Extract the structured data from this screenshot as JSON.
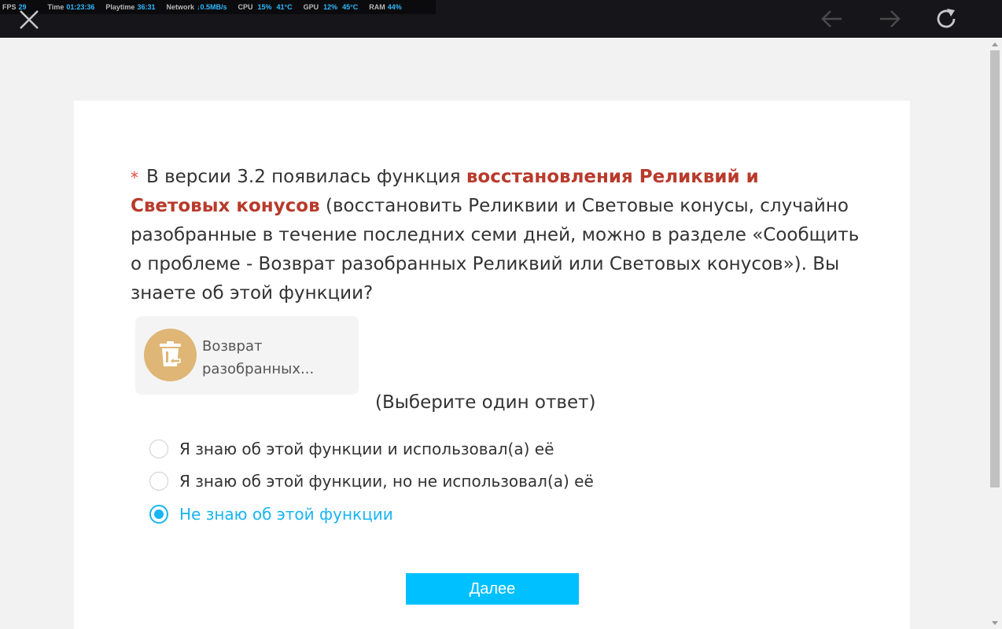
{
  "perf_overlay": {
    "fps_label": "FPS",
    "fps_value": "29",
    "time_label": "Time",
    "time_value": "01:23:36",
    "playtime_label": "Playtime",
    "playtime_value": "36:31",
    "network_label": "Network",
    "network_value": "↓0.5MB/s",
    "cpu_label": "CPU",
    "cpu_load": "15%",
    "cpu_temp": "41°C",
    "gpu_label": "GPU",
    "gpu_load": "12%",
    "gpu_temp": "45°C",
    "ram_label": "RAM",
    "ram_value": "44%"
  },
  "toolbar": {
    "icons": [
      "close-icon",
      "arrow-left-icon",
      "arrow-right-icon",
      "reload-icon"
    ],
    "icon_color_active": "#c8c8c8",
    "icon_color_disabled": "#4a4a4a"
  },
  "question": {
    "required_mark": "*",
    "text_before": "В версии 3.2 появилась функция ",
    "highlight": "восстановления Реликвий и Световых конусов",
    "text_after": " (восстановить Реликвии и Световые конусы, случайно разобранные в течение последних семи дней, можно в разделе «Сообщить о проблеме - Возврат разобранных Реликвий или Световых конусов»). Вы знаете об этой функции?",
    "highlight_color": "#b83a2c"
  },
  "feature_image": {
    "icon": "trash-restore-icon",
    "line1": "Возврат",
    "line2": "разобранных..."
  },
  "hint": "(Выберите один ответ)",
  "options": [
    {
      "label": "Я знаю об этой функции и использовал(а) её",
      "selected": false
    },
    {
      "label": "Я знаю об этой функции, но не использовал(а) её",
      "selected": false
    },
    {
      "label": "Не знаю об этой функции",
      "selected": true
    }
  ],
  "next_button": "Далее",
  "colors": {
    "accent": "#00c0ff",
    "selected": "#19b4f2"
  }
}
